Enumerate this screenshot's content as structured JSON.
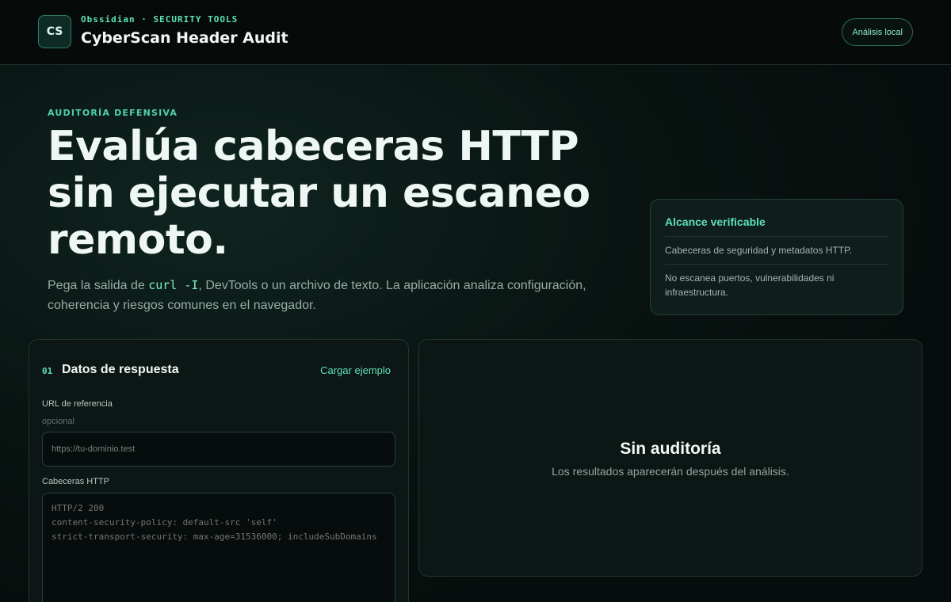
{
  "header": {
    "logo_text": "CS",
    "brand_sub": "Obssidian · SECURITY TOOLS",
    "title": "CyberScan Header Audit",
    "badge": "Análisis local"
  },
  "hero": {
    "eyebrow": "AUDITORÍA DEFENSIVA",
    "headline": "Evalúa cabeceras HTTP sin ejecutar un escaneo remoto.",
    "lede_before": "Pega la salida de ",
    "lede_code": "curl -I",
    "lede_after": ", DevTools o un archivo de texto. La aplicación analiza configuración, coherencia y riesgos comunes en el navegador."
  },
  "scope": {
    "title": "Alcance verificable",
    "items": [
      "Cabeceras de seguridad y metadatos HTTP.",
      "No escanea puertos, vulnerabilidades ni infraestructura."
    ]
  },
  "input_panel": {
    "step": "01",
    "title": "Datos de respuesta",
    "load_example": "Cargar ejemplo",
    "url_label": "URL de referencia",
    "url_hint": "opcional",
    "url_placeholder": "https://tu-dominio.test",
    "headers_label": "Cabeceras HTTP",
    "headers_placeholder": "HTTP/2 200\ncontent-security-policy: default-src 'self'\nstrict-transport-security: max-age=31536000; includeSubDomains"
  },
  "results_panel": {
    "empty_title": "Sin auditoría",
    "empty_subtitle": "Los resultados aparecerán después del análisis."
  },
  "colors": {
    "accent": "#5fe0b8",
    "background": "#070d0c",
    "panel": "#0c1614"
  }
}
